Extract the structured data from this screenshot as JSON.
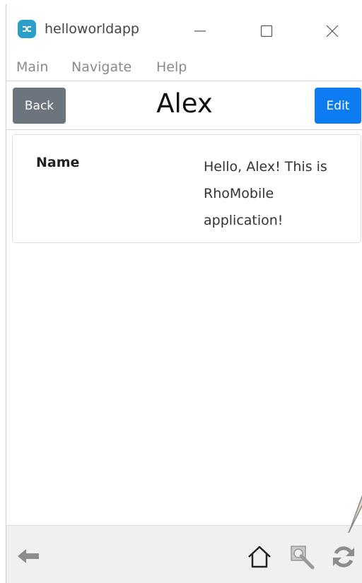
{
  "window": {
    "app_title": "helloworldapp",
    "icons": {
      "app": "app-logo-icon",
      "minimize": "minimize-icon",
      "maximize": "maximize-icon",
      "close": "close-icon"
    }
  },
  "menu": {
    "items": [
      {
        "label": "Main"
      },
      {
        "label": "Navigate"
      },
      {
        "label": "Help"
      }
    ]
  },
  "header": {
    "back_label": "Back",
    "title": "Alex",
    "edit_label": "Edit"
  },
  "record": {
    "field_label": "Name",
    "field_value": "Hello, Alex! This is RhoMobile application!"
  },
  "toolbar": {
    "icons": [
      "back-arrow-icon",
      "home-icon",
      "zoom-icon",
      "refresh-icon"
    ]
  },
  "colors": {
    "back_button": "#6c757d",
    "edit_button": "#0d7bf2",
    "app_icon": "#2b9fc9",
    "toolbar_bg": "#f0f0f0"
  }
}
